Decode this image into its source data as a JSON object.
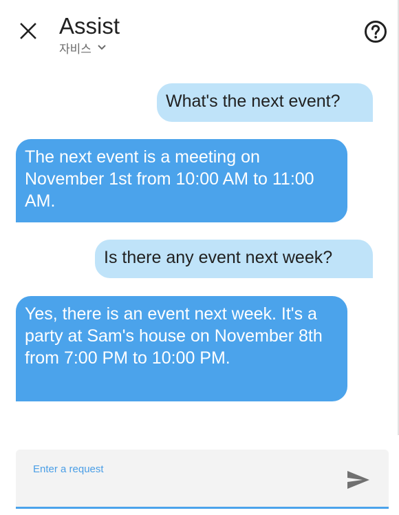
{
  "header": {
    "title": "Assist",
    "pipeline": "자비스",
    "close_icon": "close-icon",
    "help_icon": "help-circle-icon",
    "dropdown_icon": "chevron-down-icon"
  },
  "messages": [
    {
      "role": "user",
      "text": "What's the next event?"
    },
    {
      "role": "assistant",
      "text": "The next event is a meeting on November 1st from 10:00 AM to 11:00 AM."
    },
    {
      "role": "user",
      "text": "Is there any event next week?"
    },
    {
      "role": "assistant",
      "text": "Yes, there is an event next week. It's a party at Sam's house on November 8th from 7:00 PM to 10:00 PM."
    }
  ],
  "input": {
    "label": "Enter a request",
    "value": "",
    "send_icon": "send-icon"
  },
  "colors": {
    "user_bubble": "#bfe3f9",
    "assistant_bubble": "#4ba3eb",
    "accent": "#4ba3eb"
  }
}
